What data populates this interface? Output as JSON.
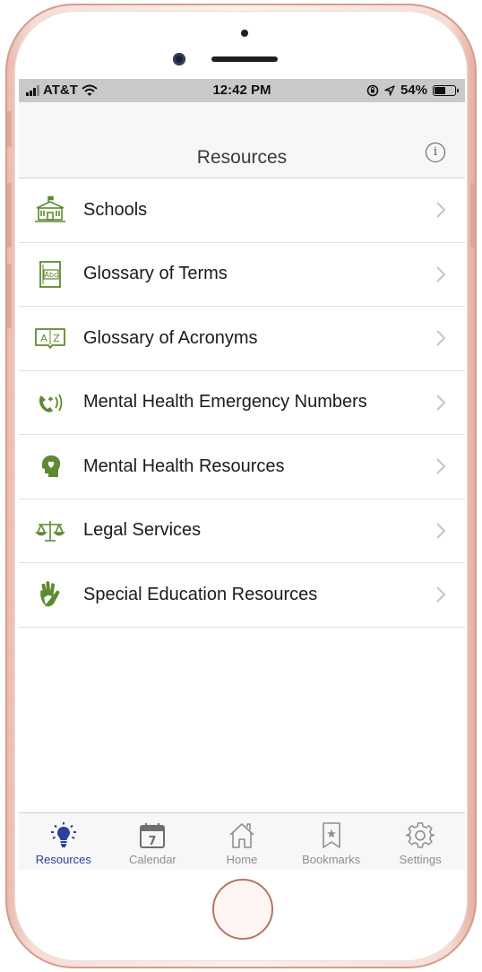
{
  "device": {
    "frame_color": "#f6ddd5",
    "accent_color": "#2d3e9c",
    "icon_color": "#5d8a2f"
  },
  "status_bar": {
    "carrier": "AT&T",
    "wifi_icon": "wifi-icon",
    "time": "12:42 PM",
    "battery_percent": "54%",
    "battery_level": 0.54
  },
  "header": {
    "title": "Resources",
    "info_icon": "info-icon",
    "info_glyph": "i"
  },
  "resources": [
    {
      "label": "Schools",
      "icon": "school-building-icon"
    },
    {
      "label": "Glossary of Terms",
      "icon": "abc-book-icon"
    },
    {
      "label": "Glossary of Acronyms",
      "icon": "a-z-book-icon"
    },
    {
      "label": "Mental Health Emergency Numbers",
      "icon": "emergency-phone-icon"
    },
    {
      "label": "Mental Health Resources",
      "icon": "head-heart-icon"
    },
    {
      "label": "Legal Services",
      "icon": "scales-icon"
    },
    {
      "label": "Special Education Resources",
      "icon": "hand-icon"
    }
  ],
  "tab_bar": {
    "tabs": [
      {
        "label": "Resources",
        "icon": "lightbulb-icon",
        "active": true
      },
      {
        "label": "Calendar",
        "icon": "calendar-icon",
        "calendar_day": "7",
        "active": false
      },
      {
        "label": "Home",
        "icon": "home-icon",
        "active": false
      },
      {
        "label": "Bookmarks",
        "icon": "bookmark-icon",
        "active": false
      },
      {
        "label": "Settings",
        "icon": "gear-icon",
        "active": false
      }
    ]
  }
}
